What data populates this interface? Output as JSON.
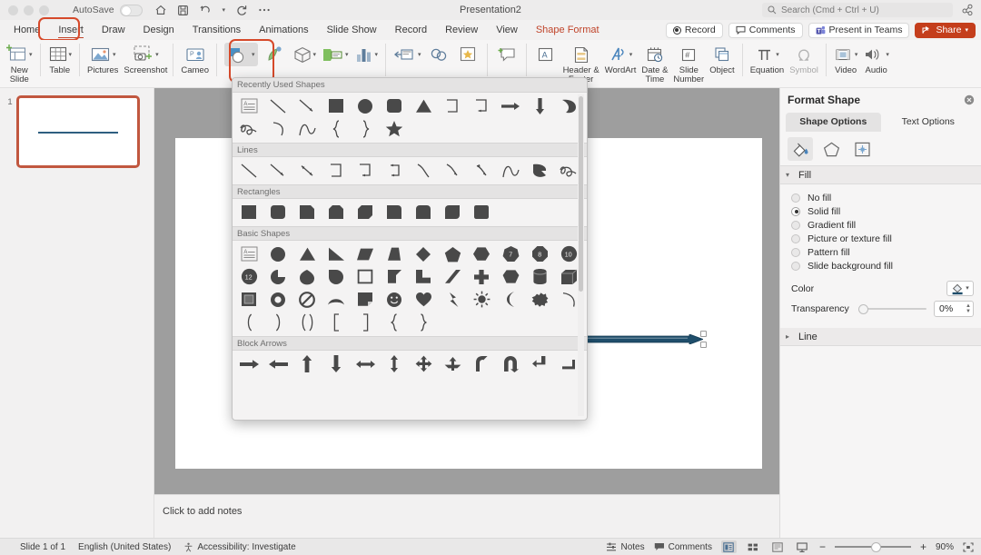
{
  "titlebar": {
    "autosave_label": "AutoSave",
    "autosave_state": "off",
    "document_title": "Presentation2",
    "icons": [
      "home-icon",
      "save-icon",
      "undo-icon",
      "undo-caret-icon",
      "redo-icon",
      "more-icon"
    ],
    "search_placeholder": "Search (Cmd + Ctrl + U)",
    "share_sidebar_icon": "share-users-icon"
  },
  "menu": {
    "tabs": [
      {
        "label": "Home",
        "active": false
      },
      {
        "label": "Insert",
        "active": true,
        "annotated": true
      },
      {
        "label": "Draw",
        "active": false
      },
      {
        "label": "Design",
        "active": false
      },
      {
        "label": "Transitions",
        "active": false
      },
      {
        "label": "Animations",
        "active": false
      },
      {
        "label": "Slide Show",
        "active": false
      },
      {
        "label": "Record",
        "active": false
      },
      {
        "label": "Review",
        "active": false
      },
      {
        "label": "View",
        "active": false
      },
      {
        "label": "Shape Format",
        "active": false,
        "accent": true
      }
    ],
    "right_buttons": [
      {
        "label": "Record",
        "icon": "record-dot-icon"
      },
      {
        "label": "Comments",
        "icon": "comment-bubble-icon"
      },
      {
        "label": "Present in Teams",
        "icon": "teams-icon"
      },
      {
        "label": "Share",
        "icon": "share-icon",
        "caret": true,
        "style": "red"
      }
    ],
    "accent_color": "#c0442a"
  },
  "ribbon": {
    "items": [
      {
        "label": "New\nSlide",
        "icon": "new-slide-icon",
        "caret": true
      },
      {
        "label": "Table",
        "icon": "table-icon",
        "caret": true
      },
      {
        "label": "Pictures",
        "icon": "pictures-icon",
        "caret": true
      },
      {
        "label": "Screenshot",
        "icon": "screenshot-icon",
        "caret": true
      },
      {
        "label": "Cameo",
        "icon": "cameo-icon",
        "caret": false
      },
      {
        "label": "Shapes",
        "icon": "shapes-icon",
        "caret": true,
        "selected": true,
        "annotated": true
      },
      {
        "label": "Icons",
        "icon": "icons-icon",
        "caret": false
      },
      {
        "label": "3D Models",
        "icon": "3d-model-icon",
        "caret": true
      },
      {
        "label": "SmartArt",
        "icon": "smartart-icon",
        "caret": true
      },
      {
        "label": "Chart",
        "icon": "chart-icon",
        "caret": true
      },
      {
        "label": "Link",
        "icon": "link-icon",
        "caret": true
      },
      {
        "label": "Zoom",
        "icon": "zoom-link-icon",
        "caret": false
      },
      {
        "label": "Action",
        "icon": "action-star-icon",
        "caret": false
      },
      {
        "label": "Comment",
        "icon": "new-comment-icon",
        "caret": false
      },
      {
        "label": "Text Box",
        "icon": "text-box-icon",
        "caret": false
      },
      {
        "label": "Header &\nFooter",
        "icon": "header-footer-icon",
        "caret": false
      },
      {
        "label": "WordArt",
        "icon": "wordart-icon",
        "caret": true
      },
      {
        "label": "Date &\nTime",
        "icon": "date-time-icon",
        "caret": false
      },
      {
        "label": "Slide\nNumber",
        "icon": "slide-number-icon",
        "caret": false
      },
      {
        "label": "Object",
        "icon": "object-icon",
        "caret": false
      },
      {
        "label": "Equation",
        "icon": "equation-icon",
        "caret": true
      },
      {
        "label": "Symbol",
        "icon": "symbol-icon",
        "caret": false,
        "disabled": true
      },
      {
        "label": "Video",
        "icon": "video-icon",
        "caret": true
      },
      {
        "label": "Audio",
        "icon": "audio-icon",
        "caret": true
      }
    ],
    "annotation_color": "#d6492a"
  },
  "shapes_panel": {
    "sections": [
      {
        "title": "Recently Used Shapes",
        "shapes": [
          "text-box",
          "line",
          "line-arrow",
          "rectangle",
          "oval",
          "rounded-rectangle",
          "triangle",
          "elbow-connector",
          "elbow-arrow-connector",
          "right-arrow",
          "down-arrow",
          "pie-wedge",
          "scribble",
          "arc",
          "curve",
          "left-brace",
          "right-brace",
          "star-5-point"
        ]
      },
      {
        "title": "Lines",
        "shapes": [
          "line",
          "line-arrow",
          "line-double-arrow",
          "elbow-connector",
          "elbow-arrow-connector",
          "elbow-double-arrow-connector",
          "curved-connector",
          "curved-arrow-connector",
          "curved-double-arrow-connector",
          "curve",
          "freeform-shape",
          "scribble"
        ]
      },
      {
        "title": "Rectangles",
        "shapes": [
          "rectangle",
          "rounded-rectangle",
          "snip-single-corner-rectangle",
          "snip-same-side-corner-rectangle",
          "snip-diagonal-corner-rectangle",
          "round-single-corner-rectangle",
          "round-same-side-corner-rectangle",
          "round-diagonal-corner-rectangle",
          "rectangle-rounded-corner"
        ]
      },
      {
        "title": "Basic Shapes",
        "shapes": [
          "text-box",
          "oval",
          "isosceles-triangle",
          "right-triangle",
          "parallelogram",
          "trapezoid",
          "diamond",
          "pentagon",
          "hexagon",
          "heptagon",
          "octagon",
          "decagon",
          "dodecagon",
          "pie",
          "teardrop",
          "chord",
          "frame",
          "l-shape",
          "corner",
          "diagonal-stripe",
          "cross",
          "regular-pentagon",
          "can",
          "cube",
          "bevel",
          "donut",
          "no-symbol",
          "arc-shape",
          "folded-corner",
          "smiley-face",
          "heart",
          "lightning-bolt",
          "sun",
          "moon",
          "cloud",
          "arc-line",
          "left-parenthesis",
          "right-parenthesis",
          "double-brace",
          "left-bracket",
          "right-bracket",
          "left-brace",
          "right-brace"
        ]
      },
      {
        "title": "Block Arrows",
        "shapes": [
          "right-arrow",
          "left-arrow",
          "up-arrow",
          "down-arrow",
          "left-right-arrow",
          "up-down-arrow",
          "quad-arrow",
          "left-right-up-arrow",
          "bent-arrow",
          "u-turn-arrow",
          "left-up-arrow",
          "bent-up-arrow"
        ]
      }
    ]
  },
  "thumbnails": {
    "slides": [
      {
        "number": "1",
        "selected": true,
        "content": "horizontal-line"
      }
    ],
    "selection_color": "#c1573f"
  },
  "canvas": {
    "selected_shape": "right-arrow-line",
    "shape_fill_color": "#1f4e6b",
    "handles": 2
  },
  "notes": {
    "placeholder": "Click to add notes"
  },
  "format_pane": {
    "title": "Format Shape",
    "close_icon": "close-circle-icon",
    "tabs": [
      {
        "label": "Shape Options",
        "active": true
      },
      {
        "label": "Text Options",
        "active": false
      }
    ],
    "icon_tabs": [
      {
        "icon": "fill-bucket-icon",
        "active": true
      },
      {
        "icon": "pentagon-effects-icon",
        "active": false
      },
      {
        "icon": "size-layout-icon",
        "active": false
      }
    ],
    "fill_section": {
      "title": "Fill",
      "expanded": true,
      "options": [
        {
          "label": "No fill",
          "selected": false
        },
        {
          "label": "Solid fill",
          "selected": true
        },
        {
          "label": "Gradient fill",
          "selected": false
        },
        {
          "label": "Picture or texture fill",
          "selected": false
        },
        {
          "label": "Pattern fill",
          "selected": false
        },
        {
          "label": "Slide background fill",
          "selected": false
        }
      ],
      "color_label": "Color",
      "color_icon": "fill-color-icon",
      "transparency_label": "Transparency",
      "transparency_value": "0%"
    },
    "line_section": {
      "title": "Line",
      "expanded": false
    }
  },
  "statusbar": {
    "slide_indicator": "Slide 1 of 1",
    "language": "English (United States)",
    "accessibility": "Accessibility: Investigate",
    "accessibility_icon": "accessibility-icon",
    "notes_label": "Notes",
    "notes_icon": "notes-icon",
    "comments_label": "Comments",
    "comments_icon": "comment-icon",
    "view_buttons": [
      {
        "icon": "normal-view-icon",
        "active": true
      },
      {
        "icon": "slide-sorter-icon",
        "active": false
      },
      {
        "icon": "reading-view-icon",
        "active": false
      },
      {
        "icon": "slideshow-view-icon",
        "active": false
      }
    ],
    "zoom_out": "−",
    "zoom_in": "+",
    "zoom_level": "90%",
    "fit_icon": "fit-to-window-icon"
  }
}
